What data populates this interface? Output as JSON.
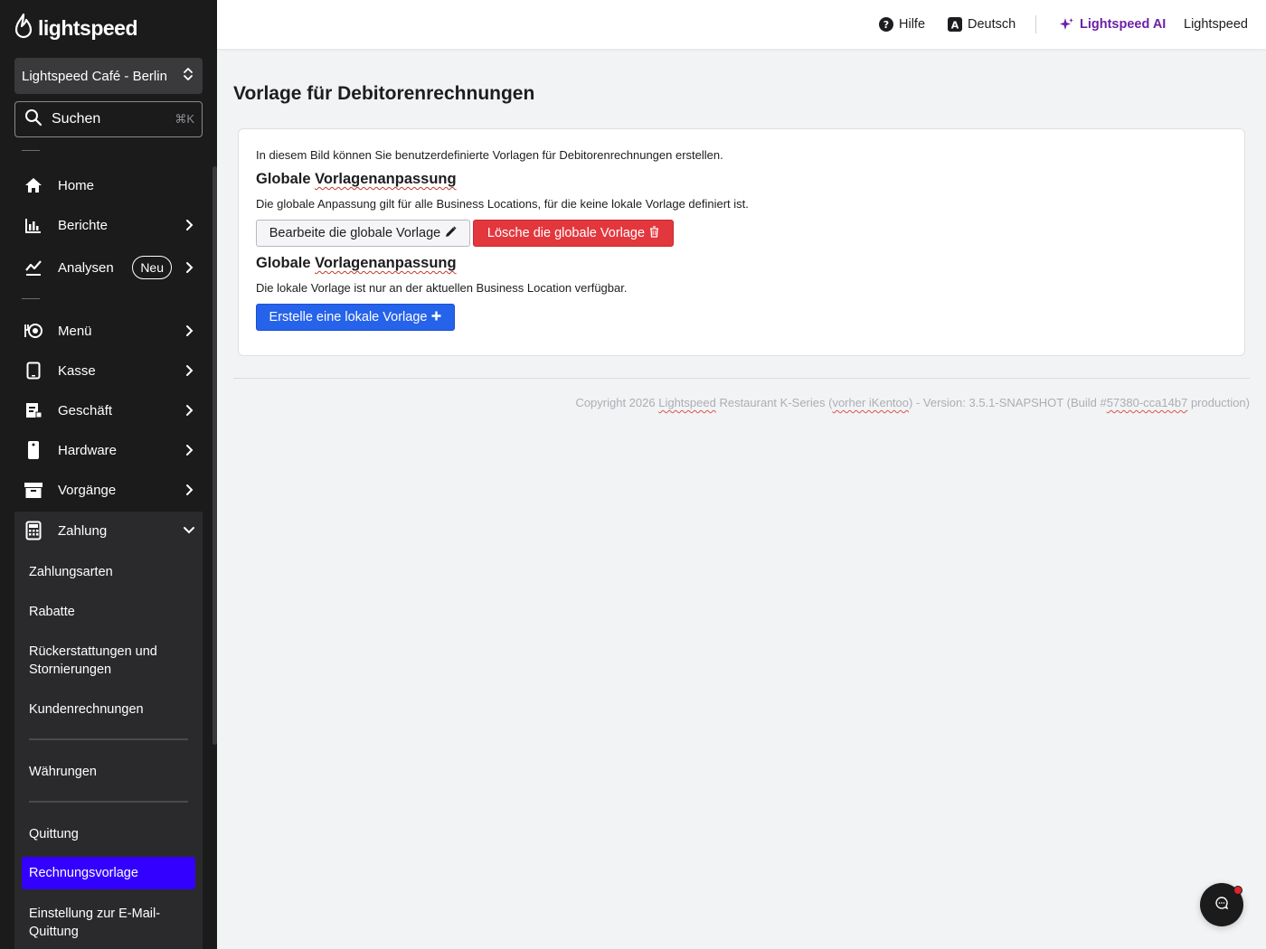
{
  "brand": {
    "logo_text": "lightspeed"
  },
  "sidebar": {
    "location": "Lightspeed Café - Berlin",
    "search": {
      "label": "Suchen",
      "shortcut": "⌘K"
    },
    "nav": [
      {
        "label": "Home",
        "icon": "home-icon"
      },
      {
        "label": "Berichte",
        "icon": "bar-chart-icon"
      },
      {
        "label": "Analysen",
        "icon": "trend-line-icon",
        "badge": "Neu"
      },
      {
        "label": "Menü",
        "icon": "menu-dish-icon"
      },
      {
        "label": "Kasse",
        "icon": "tablet-icon"
      },
      {
        "label": "Geschäft",
        "icon": "store-doc-icon"
      },
      {
        "label": "Hardware",
        "icon": "hardware-icon"
      },
      {
        "label": "Vorgänge",
        "icon": "archive-icon"
      }
    ],
    "payment": {
      "label": "Zahlung",
      "icon": "calculator-icon",
      "items": [
        {
          "label": "Zahlungsarten"
        },
        {
          "label": "Rabatte"
        },
        {
          "label": "Rückerstattungen und Stornierungen"
        },
        {
          "label": "Kundenrechnungen"
        },
        {
          "label": "Währungen"
        },
        {
          "label": "Quittung"
        },
        {
          "label": "Rechnungsvorlage",
          "active": true
        },
        {
          "label": "Einstellung zur E-Mail-Quittung"
        }
      ]
    }
  },
  "topbar": {
    "help": "Hilfe",
    "language": "Deutsch",
    "ai": "Lightspeed AI",
    "account": "Lightspeed",
    "ai_color": "#6b21a8"
  },
  "main": {
    "title": "Vorlage für Debitorenrechnungen",
    "intro": "In diesem Bild können Sie benutzerdefinierte Vorlagen für Debitorenrechnungen erstellen.",
    "global_section": {
      "heading_a": "Globale",
      "heading_b": "Vorlagenanpassung",
      "description": "Die globale Anpassung gilt für alle Business Locations, für die keine lokale Vorlage definiert ist.",
      "edit_button": "Bearbeite die globale Vorlage",
      "delete_button": "Lösche die globale Vorlage"
    },
    "local_section": {
      "heading_a": "Globale",
      "heading_b": "Vorlagenanpassung",
      "description": "Die lokale Vorlage ist nur an der aktuellen Business Location verfügbar.",
      "create_button": "Erstelle eine lokale Vorlage"
    }
  },
  "footer": {
    "part1": "Copyright 2026 ",
    "part2": "Lightspeed",
    "part3": " Restaurant K-Series (",
    "part4": "vorher iKentoo",
    "part5": ") - Version: 3.5.1-SNAPSHOT (Build #",
    "part6": "57380-cca14b7",
    "part7": " production)"
  },
  "colors": {
    "accent": "#3300ff",
    "danger": "#e3373e",
    "primary": "#2563eb",
    "sidebar_bg": "#1b1b1c"
  }
}
